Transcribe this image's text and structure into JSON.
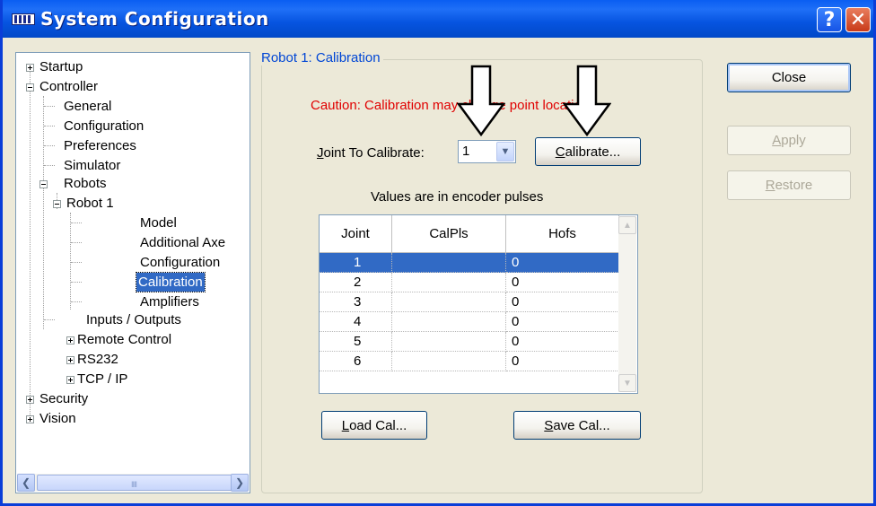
{
  "window": {
    "title": "System Configuration",
    "help_glyph": "?",
    "close_glyph": "✕"
  },
  "tree": {
    "items": [
      {
        "label": "Startup",
        "expander": "plus"
      },
      {
        "label": "Controller",
        "expander": "minus"
      },
      {
        "label": "General"
      },
      {
        "label": "Configuration"
      },
      {
        "label": "Preferences"
      },
      {
        "label": "Simulator"
      },
      {
        "label": "Robots",
        "expander": "minus"
      },
      {
        "label": "Robot 1",
        "expander": "minus"
      },
      {
        "label": "Model"
      },
      {
        "label": "Additional Axe"
      },
      {
        "label": "Configuration"
      },
      {
        "label": "Calibration",
        "selected": true
      },
      {
        "label": "Amplifiers"
      },
      {
        "label": "Inputs / Outputs"
      },
      {
        "label": "Remote Control",
        "expander": "plus"
      },
      {
        "label": "RS232",
        "expander": "plus"
      },
      {
        "label": "TCP / IP",
        "expander": "plus"
      },
      {
        "label": "Security",
        "expander": "plus"
      },
      {
        "label": "Vision",
        "expander": "plus"
      }
    ],
    "scroll_left": "❮",
    "scroll_right": "❯",
    "scroll_grip": "IIII"
  },
  "panel": {
    "group_title": "Robot 1: Calibration",
    "caution": "Caution: Calibration may change point locations",
    "joint_label_prefix": "J",
    "joint_label_rest": "oint To Calibrate:",
    "joint_value": "1",
    "combo_arrow": "▼",
    "calibrate_ul": "C",
    "calibrate_rest": "alibrate...",
    "values_note": "Values are in encoder pulses",
    "load_ul": "L",
    "load_rest": "oad Cal...",
    "save_ul": "S",
    "save_rest": "ave Cal..."
  },
  "grid": {
    "columns": [
      "Joint",
      "CalPls",
      "Hofs"
    ],
    "rows": [
      {
        "joint": "1",
        "calpls": "",
        "hofs": "0",
        "selected": true
      },
      {
        "joint": "2",
        "calpls": "",
        "hofs": "0"
      },
      {
        "joint": "3",
        "calpls": "",
        "hofs": "0"
      },
      {
        "joint": "4",
        "calpls": "",
        "hofs": "0"
      },
      {
        "joint": "5",
        "calpls": "",
        "hofs": "0"
      },
      {
        "joint": "6",
        "calpls": "",
        "hofs": "0"
      }
    ],
    "scroll_up": "▲",
    "scroll_down": "▼"
  },
  "side_buttons": {
    "close": "Close",
    "apply_ul": "A",
    "apply_rest": "pply",
    "restore_ul": "R",
    "restore_rest": "estore",
    "apply_enabled": false,
    "restore_enabled": false
  },
  "colors": {
    "selection": "#316ac5",
    "caution": "#e00000",
    "group_title": "#0046d5",
    "titlebar": "#0a5ef2"
  }
}
